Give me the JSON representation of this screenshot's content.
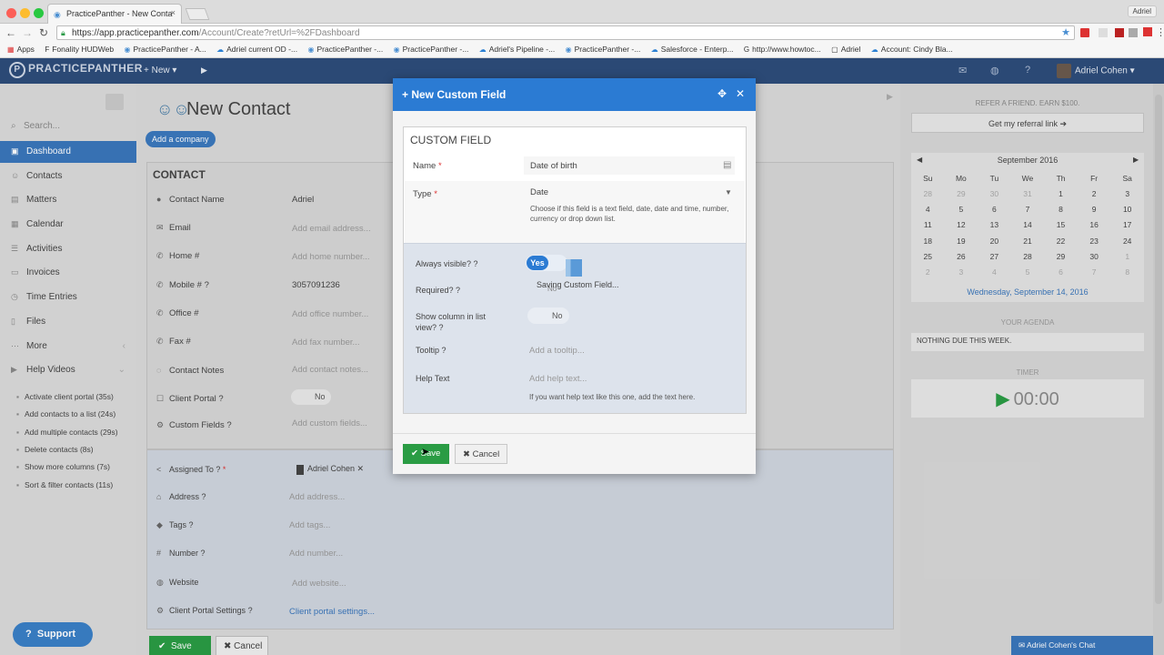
{
  "browser": {
    "tab_title": "PracticePanther - New Conta",
    "user_badge": "Adriel",
    "url_host": "https://app.practicepanther.com",
    "url_path": "/Account/Create?retUrl=%2FDashboard",
    "bookmarks": [
      "Apps",
      "Fonality HUDWeb",
      "PracticePanther - A...",
      "Adriel current OD -...",
      "PracticePanther -...",
      "PracticePanther -...",
      "Adriel's Pipeline -...",
      "PracticePanther -...",
      "Salesforce - Enterp...",
      "http://www.howtoc...",
      "Adriel",
      "Account: Cindy Bla..."
    ]
  },
  "app": {
    "logo": "PRACTICEPANTHER",
    "new_label": "+ New",
    "user_name": "Adriel Cohen"
  },
  "sidebar": {
    "search_placeholder": "Search...",
    "items": [
      {
        "label": "Dashboard",
        "icon": "dashboard-icon"
      },
      {
        "label": "Contacts",
        "icon": "contacts-icon"
      },
      {
        "label": "Matters",
        "icon": "matters-icon"
      },
      {
        "label": "Calendar",
        "icon": "calendar-icon"
      },
      {
        "label": "Activities",
        "icon": "activities-icon"
      },
      {
        "label": "Invoices",
        "icon": "invoices-icon"
      },
      {
        "label": "Time Entries",
        "icon": "time-icon"
      },
      {
        "label": "Files",
        "icon": "files-icon"
      },
      {
        "label": "More",
        "icon": "more-icon"
      },
      {
        "label": "Help Videos",
        "icon": "video-icon"
      }
    ],
    "videos": [
      "Activate client portal (35s)",
      "Add contacts to a list (24s)",
      "Add multiple contacts (29s)",
      "Delete contacts (8s)",
      "Show more columns (7s)",
      "Sort & filter contacts (11s)"
    ],
    "support": "Support"
  },
  "main": {
    "title": "New Contact",
    "add_company": "Add a company",
    "section": "CONTACT",
    "fields": [
      {
        "label": "Contact Name",
        "value": "Adriel",
        "real": true
      },
      {
        "label": "Email",
        "value": "Add email address..."
      },
      {
        "label": "Home #",
        "value": "Add home number..."
      },
      {
        "label": "Mobile #",
        "value": "3057091236",
        "real": true
      },
      {
        "label": "Office #",
        "value": "Add office number..."
      },
      {
        "label": "Fax #",
        "value": "Add fax number..."
      },
      {
        "label": "Contact Notes",
        "value": "Add contact notes..."
      },
      {
        "label": "Client Portal",
        "value": "No"
      },
      {
        "label": "Custom Fields",
        "value": "Add custom fields..."
      }
    ],
    "fields2": [
      {
        "label": "Assigned To",
        "value": "Adriel Cohen"
      },
      {
        "label": "Address",
        "value": "Add address..."
      },
      {
        "label": "Tags",
        "value": "Add tags..."
      },
      {
        "label": "Number",
        "value": "Add number..."
      },
      {
        "label": "Website",
        "value": "Add website..."
      },
      {
        "label": "Client Portal Settings",
        "value": "Client portal settings..."
      }
    ],
    "save": "Save",
    "cancel": "Cancel"
  },
  "right": {
    "refer": "REFER A FRIEND. EARN $100.",
    "ref_button": "Get my referral link",
    "cal_title": "September 2016",
    "weekdays": [
      "Su",
      "Mo",
      "Tu",
      "We",
      "Th",
      "Fr",
      "Sa"
    ],
    "weeks": [
      [
        "28",
        "29",
        "30",
        "31",
        "1",
        "2",
        "3"
      ],
      [
        "4",
        "5",
        "6",
        "7",
        "8",
        "9",
        "10"
      ],
      [
        "11",
        "12",
        "13",
        "14",
        "15",
        "16",
        "17"
      ],
      [
        "18",
        "19",
        "20",
        "21",
        "22",
        "23",
        "24"
      ],
      [
        "25",
        "26",
        "27",
        "28",
        "29",
        "30",
        "1"
      ],
      [
        "2",
        "3",
        "4",
        "5",
        "6",
        "7",
        "8"
      ]
    ],
    "cal_date": "Wednesday, September 14, 2016",
    "agenda_title": "YOUR AGENDA",
    "agenda_text": "NOTHING DUE THIS WEEK.",
    "timer_title": "TIMER",
    "timer": "00:00",
    "chat": "Adriel Cohen's Chat"
  },
  "modal": {
    "header": "+ New Custom Field",
    "box_title": "CUSTOM FIELD",
    "name_label": "Name",
    "name_value": "Date of birth",
    "type_label": "Type",
    "type_value": "Date",
    "type_help": "Choose if this field is a text field, date, date and time, number, currency or drop down list.",
    "always_visible": "Always visible?",
    "yes": "Yes",
    "required": "Required?",
    "saving": "Saving Custom Field...",
    "required_value": "No",
    "show_column": "Show column in list view?",
    "show_column_value": "No",
    "tooltip_label": "Tooltip",
    "tooltip_placeholder": "Add a tooltip...",
    "help_label": "Help Text",
    "help_placeholder": "Add help text...",
    "help_sub": "If you want help text like this one, add the text here.",
    "save": "Save",
    "cancel": "Cancel"
  }
}
